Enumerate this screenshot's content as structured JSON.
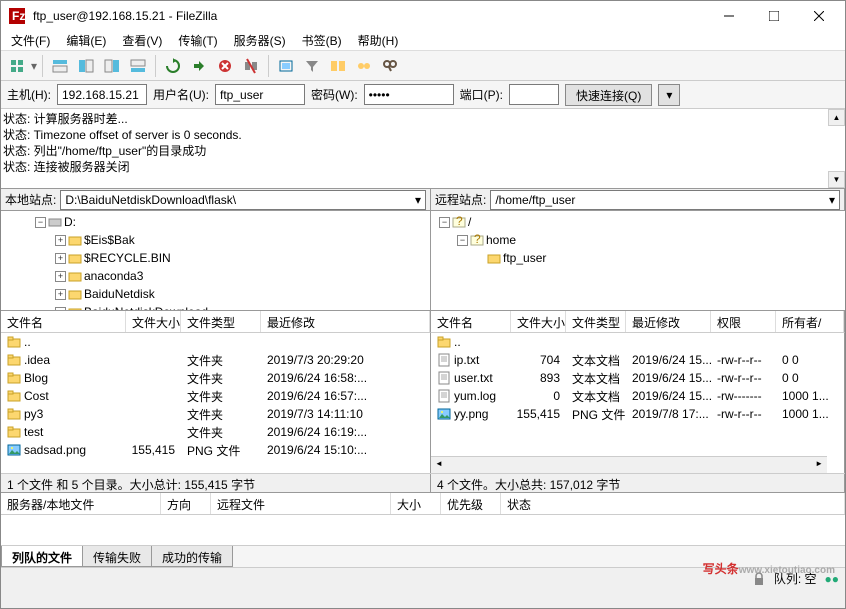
{
  "title": "ftp_user@192.168.15.21 - FileZilla",
  "menus": [
    "文件(F)",
    "编辑(E)",
    "查看(V)",
    "传输(T)",
    "服务器(S)",
    "书签(B)",
    "帮助(H)"
  ],
  "conn": {
    "host_label": "主机(H):",
    "host": "192.168.15.21",
    "user_label": "用户名(U):",
    "user": "ftp_user",
    "pass_label": "密码(W):",
    "pass": "•••••",
    "port_label": "端口(P):",
    "port": "",
    "connect": "快速连接(Q)"
  },
  "log_lines": [
    "状态:    计算服务器时差...",
    "状态:    Timezone offset of server is 0 seconds.",
    "状态:    列出\"/home/ftp_user\"的目录成功",
    "状态:    连接被服务器关闭"
  ],
  "local_site_label": "本地站点:",
  "local_site_path": "D:\\BaiduNetdiskDownload\\flask\\",
  "remote_site_label": "远程站点:",
  "remote_site_path": "/home/ftp_user",
  "local_tree": {
    "root": "D:",
    "nodes": [
      "$Eis$Bak",
      "$RECYCLE.BIN",
      "anaconda3",
      "BaiduNetdisk",
      "BaiduNetdiskDownload"
    ]
  },
  "remote_tree": {
    "root": "/",
    "node1": "home",
    "node2": "ftp_user"
  },
  "local_cols": [
    "文件名",
    "文件大小",
    "文件类型",
    "最近修改"
  ],
  "local_files": [
    {
      "name": "..",
      "size": "",
      "type": "",
      "mod": ""
    },
    {
      "name": ".idea",
      "size": "",
      "type": "文件夹",
      "mod": "2019/7/3 20:29:20"
    },
    {
      "name": "Blog",
      "size": "",
      "type": "文件夹",
      "mod": "2019/6/24 16:58:..."
    },
    {
      "name": "Cost",
      "size": "",
      "type": "文件夹",
      "mod": "2019/6/24 16:57:..."
    },
    {
      "name": "py3",
      "size": "",
      "type": "文件夹",
      "mod": "2019/7/3 14:11:10"
    },
    {
      "name": "test",
      "size": "",
      "type": "文件夹",
      "mod": "2019/6/24 16:19:..."
    },
    {
      "name": "sadsad.png",
      "size": "155,415",
      "type": "PNG 文件",
      "mod": "2019/6/24 15:10:..."
    }
  ],
  "remote_cols": [
    "文件名",
    "文件大小",
    "文件类型",
    "最近修改",
    "权限",
    "所有者/"
  ],
  "remote_files": [
    {
      "name": "..",
      "size": "",
      "type": "",
      "mod": "",
      "perm": "",
      "own": ""
    },
    {
      "name": "ip.txt",
      "size": "704",
      "type": "文本文档",
      "mod": "2019/6/24 15...",
      "perm": "-rw-r--r--",
      "own": "0 0"
    },
    {
      "name": "user.txt",
      "size": "893",
      "type": "文本文档",
      "mod": "2019/6/24 15...",
      "perm": "-rw-r--r--",
      "own": "0 0"
    },
    {
      "name": "yum.log",
      "size": "0",
      "type": "文本文档",
      "mod": "2019/6/24 15...",
      "perm": "-rw-------",
      "own": "1000 1..."
    },
    {
      "name": "yy.png",
      "size": "155,415",
      "type": "PNG 文件",
      "mod": "2019/7/8 17:...",
      "perm": "-rw-r--r--",
      "own": "1000 1..."
    }
  ],
  "local_status": "1 个文件 和 5 个目录。大小总计: 155,415 字节",
  "remote_status": "4 个文件。大小总共: 157,012 字节",
  "queue_cols": [
    "服务器/本地文件",
    "方向",
    "远程文件",
    "大小",
    "优先级",
    "状态"
  ],
  "tabs": [
    "列队的文件",
    "传输失败",
    "成功的传输"
  ],
  "statusbar_queue": "队列: 空",
  "watermark_cn": "写头条",
  "watermark_url": "www.xietoutiao.com"
}
